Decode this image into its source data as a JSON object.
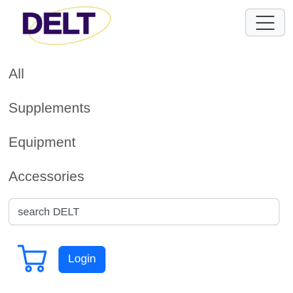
{
  "brand": {
    "logo_text": "DELT",
    "logo_color": "#2d0a5e",
    "ring_color": "#f1e38a",
    "icon": "delt-logo"
  },
  "toggler": {
    "icon": "hamburger-menu-icon"
  },
  "nav": {
    "items": [
      {
        "label": "All"
      },
      {
        "label": "Supplements"
      },
      {
        "label": "Equipment"
      },
      {
        "label": "Accessories"
      }
    ]
  },
  "search": {
    "value": "",
    "placeholder": "search DELT"
  },
  "cart": {
    "icon": "shopping-cart-icon",
    "color": "#0d6efd"
  },
  "login": {
    "label": "Login",
    "color": "#0d6efd"
  }
}
